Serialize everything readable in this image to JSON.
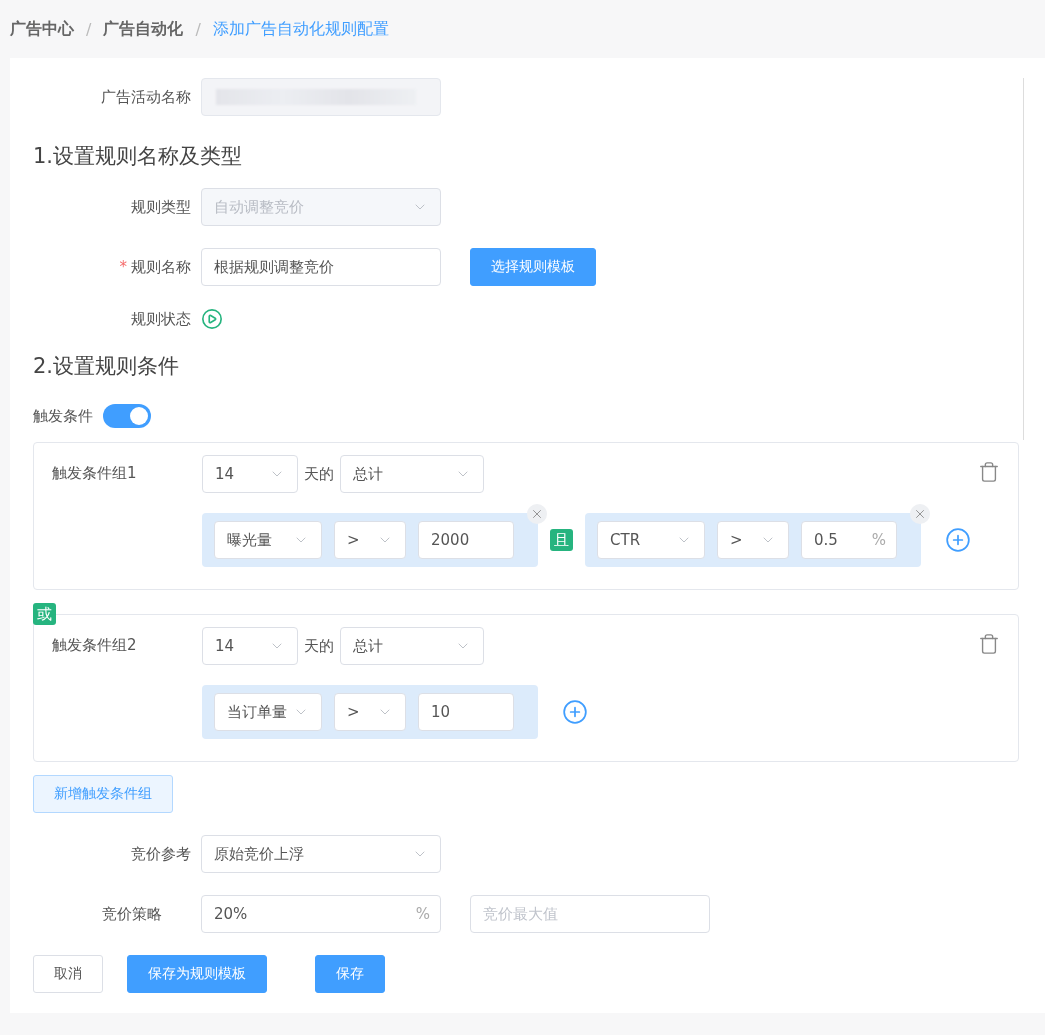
{
  "breadcrumb": [
    {
      "label": "广告中心",
      "selected": false
    },
    {
      "label": "广告自动化",
      "separator_before": "/",
      "selected": false
    },
    {
      "label": "添加广告自动化规则配置",
      "separator_before": "/",
      "selected": true
    }
  ],
  "campaign": {
    "label": "广告活动名称",
    "redacted": true
  },
  "section1": {
    "title": "1.设置规则名称及类型",
    "rule_type": {
      "label": "规则类型",
      "value": "自动调整竞价",
      "disabled": true
    },
    "rule_name": {
      "label": "规则名称",
      "required_mark": "*",
      "value": "根据规则调整竞价"
    },
    "template_button": "选择规则模板",
    "rule_status": {
      "label": "规则状态",
      "on": true
    }
  },
  "section2": {
    "title": "2.设置规则条件",
    "trigger": {
      "label": "触发条件",
      "on": true
    },
    "groups": [
      {
        "label": "触发条件组1",
        "days": "14",
        "days_suffix": "天的",
        "aggregate": "总计",
        "joiner": "且",
        "conditions": [
          {
            "metric": "曝光量",
            "operator": ">",
            "value": "2000",
            "removable": true
          },
          {
            "metric": "CTR",
            "operator": ">",
            "value": "0.5",
            "unit": "%",
            "removable": true
          }
        ]
      },
      {
        "connector": "或",
        "label": "触发条件组2",
        "days": "14",
        "days_suffix": "天的",
        "aggregate": "总计",
        "conditions": [
          {
            "metric": "当订单量",
            "operator": ">",
            "value": "10",
            "removable": false
          }
        ]
      }
    ],
    "add_group_button": "新增触发条件组"
  },
  "bid": {
    "reference": {
      "label": "竞价参考",
      "value": "原始竞价上浮"
    },
    "strategy": {
      "label": "竞价策略",
      "value": "20%",
      "unit": "%",
      "max_placeholder": "竞价最大值"
    }
  },
  "actions": [
    {
      "label": "取消",
      "kind": "default"
    },
    {
      "label": "保存为规则模板",
      "kind": "primary"
    },
    {
      "label": "保存",
      "kind": "primary"
    }
  ]
}
